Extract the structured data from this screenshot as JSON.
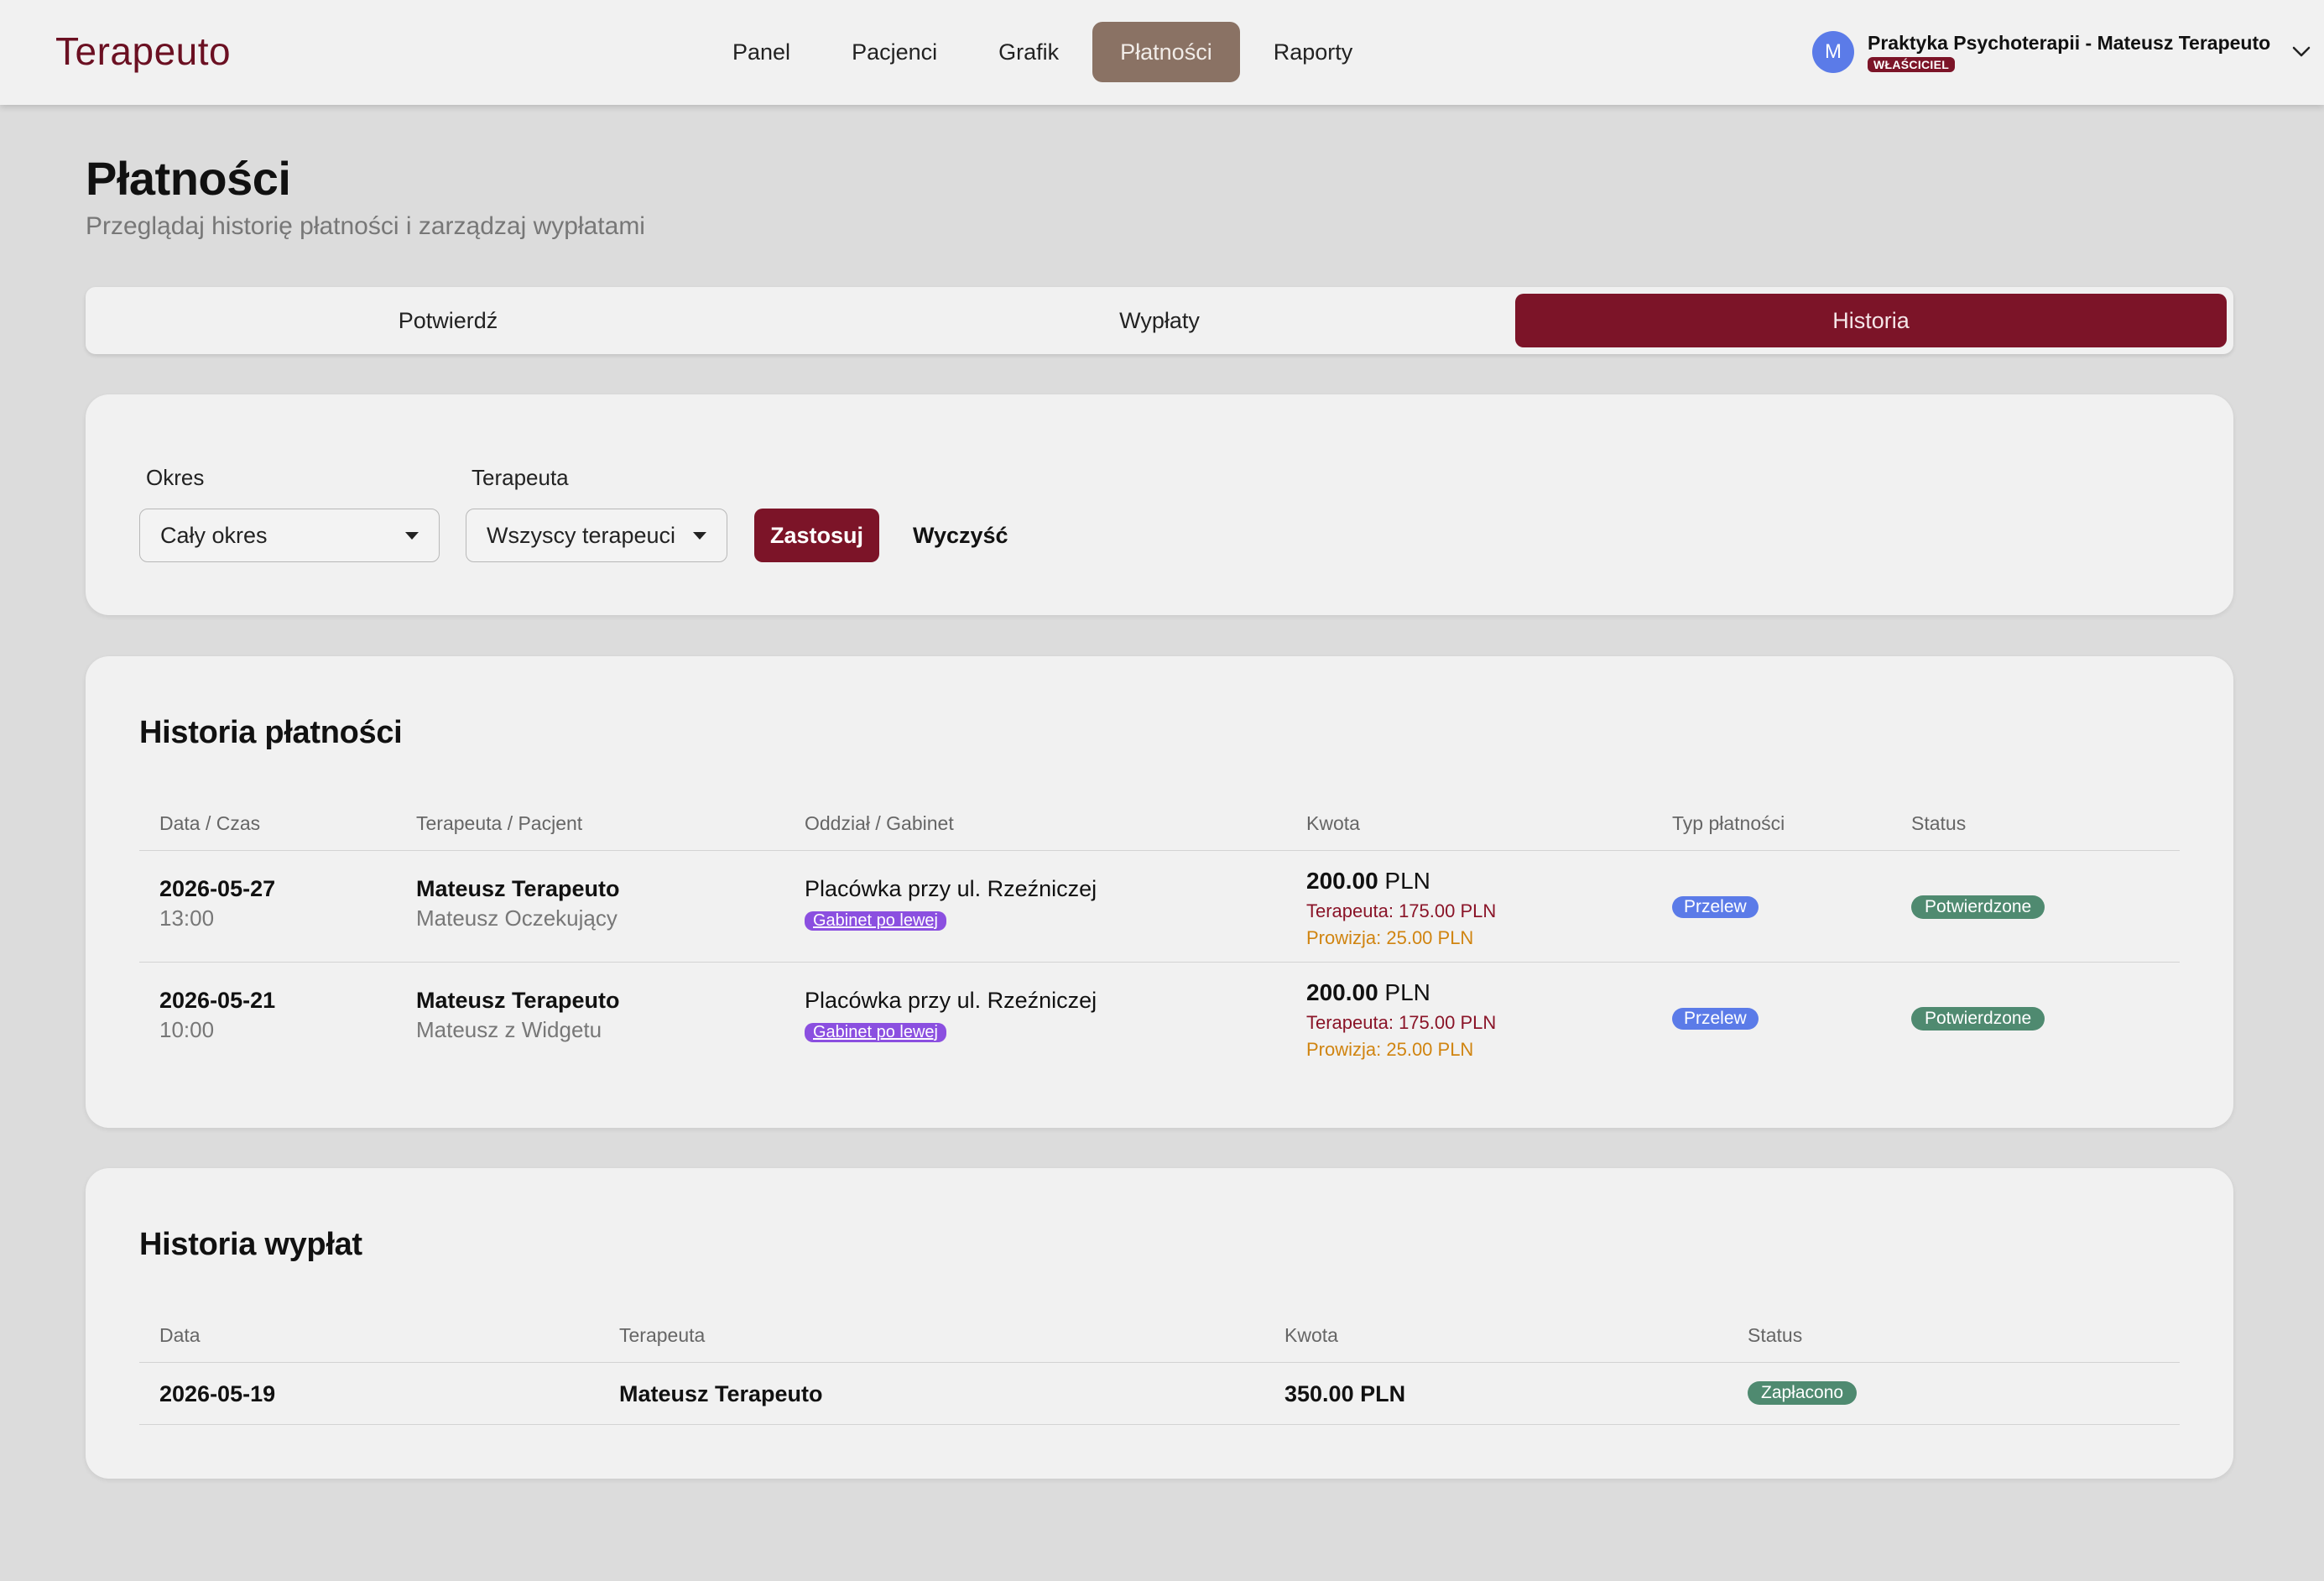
{
  "header": {
    "logo": "Terapeuto",
    "nav": [
      "Panel",
      "Pacjenci",
      "Grafik",
      "Płatności",
      "Raporty"
    ],
    "active_nav": "Płatności",
    "user": {
      "avatar_letter": "M",
      "name": "Praktyka Psychoterapii - Mateusz Terapeuto",
      "role": "WŁAŚCICIEL"
    }
  },
  "page": {
    "title": "Płatności",
    "subtitle": "Przeglądaj historię płatności i zarządzaj wypłatami"
  },
  "tabs": [
    "Potwierdź",
    "Wypłaty",
    "Historia"
  ],
  "active_tab": "Historia",
  "filters": {
    "period_label": "Okres",
    "period_value": "Cały okres",
    "therapist_label": "Terapeuta",
    "therapist_value": "Wszyscy terapeuci",
    "apply": "Zastosuj",
    "clear": "Wyczyść"
  },
  "payments": {
    "title": "Historia płatności",
    "columns": [
      "Data / Czas",
      "Terapeuta / Pacjent",
      "Oddział / Gabinet",
      "Kwota",
      "Typ płatności",
      "Status"
    ],
    "rows": [
      {
        "date": "2026-05-27",
        "time": "13:00",
        "therapist": "Mateusz Terapeuto",
        "patient": "Mateusz Oczekujący",
        "branch": "Placówka przy ul. Rzeźniczej",
        "room": "Gabinet po lewej",
        "amount_value": "200.00",
        "amount_currency": "PLN",
        "therapist_share": "Terapeuta: 175.00 PLN",
        "commission": "Prowizja: 25.00 PLN",
        "type": "Przelew",
        "status": "Potwierdzone"
      },
      {
        "date": "2026-05-21",
        "time": "10:00",
        "therapist": "Mateusz Terapeuto",
        "patient": "Mateusz z Widgetu",
        "branch": "Placówka przy ul. Rzeźniczej",
        "room": "Gabinet po lewej",
        "amount_value": "200.00",
        "amount_currency": "PLN",
        "therapist_share": "Terapeuta: 175.00 PLN",
        "commission": "Prowizja: 25.00 PLN",
        "type": "Przelew",
        "status": "Potwierdzone"
      }
    ]
  },
  "payouts": {
    "title": "Historia wypłat",
    "columns": [
      "Data",
      "Terapeuta",
      "Kwota",
      "Status"
    ],
    "rows": [
      {
        "date": "2026-05-19",
        "therapist": "Mateusz Terapeuto",
        "amount": "350.00 PLN",
        "status": "Zapłacono"
      }
    ]
  },
  "colors": {
    "brand": "#7c1428",
    "nav_active": "#8a7264",
    "status_green": "#4f8a70",
    "type_blue": "#5b7be8",
    "room_purple": "#8b4fe0"
  }
}
